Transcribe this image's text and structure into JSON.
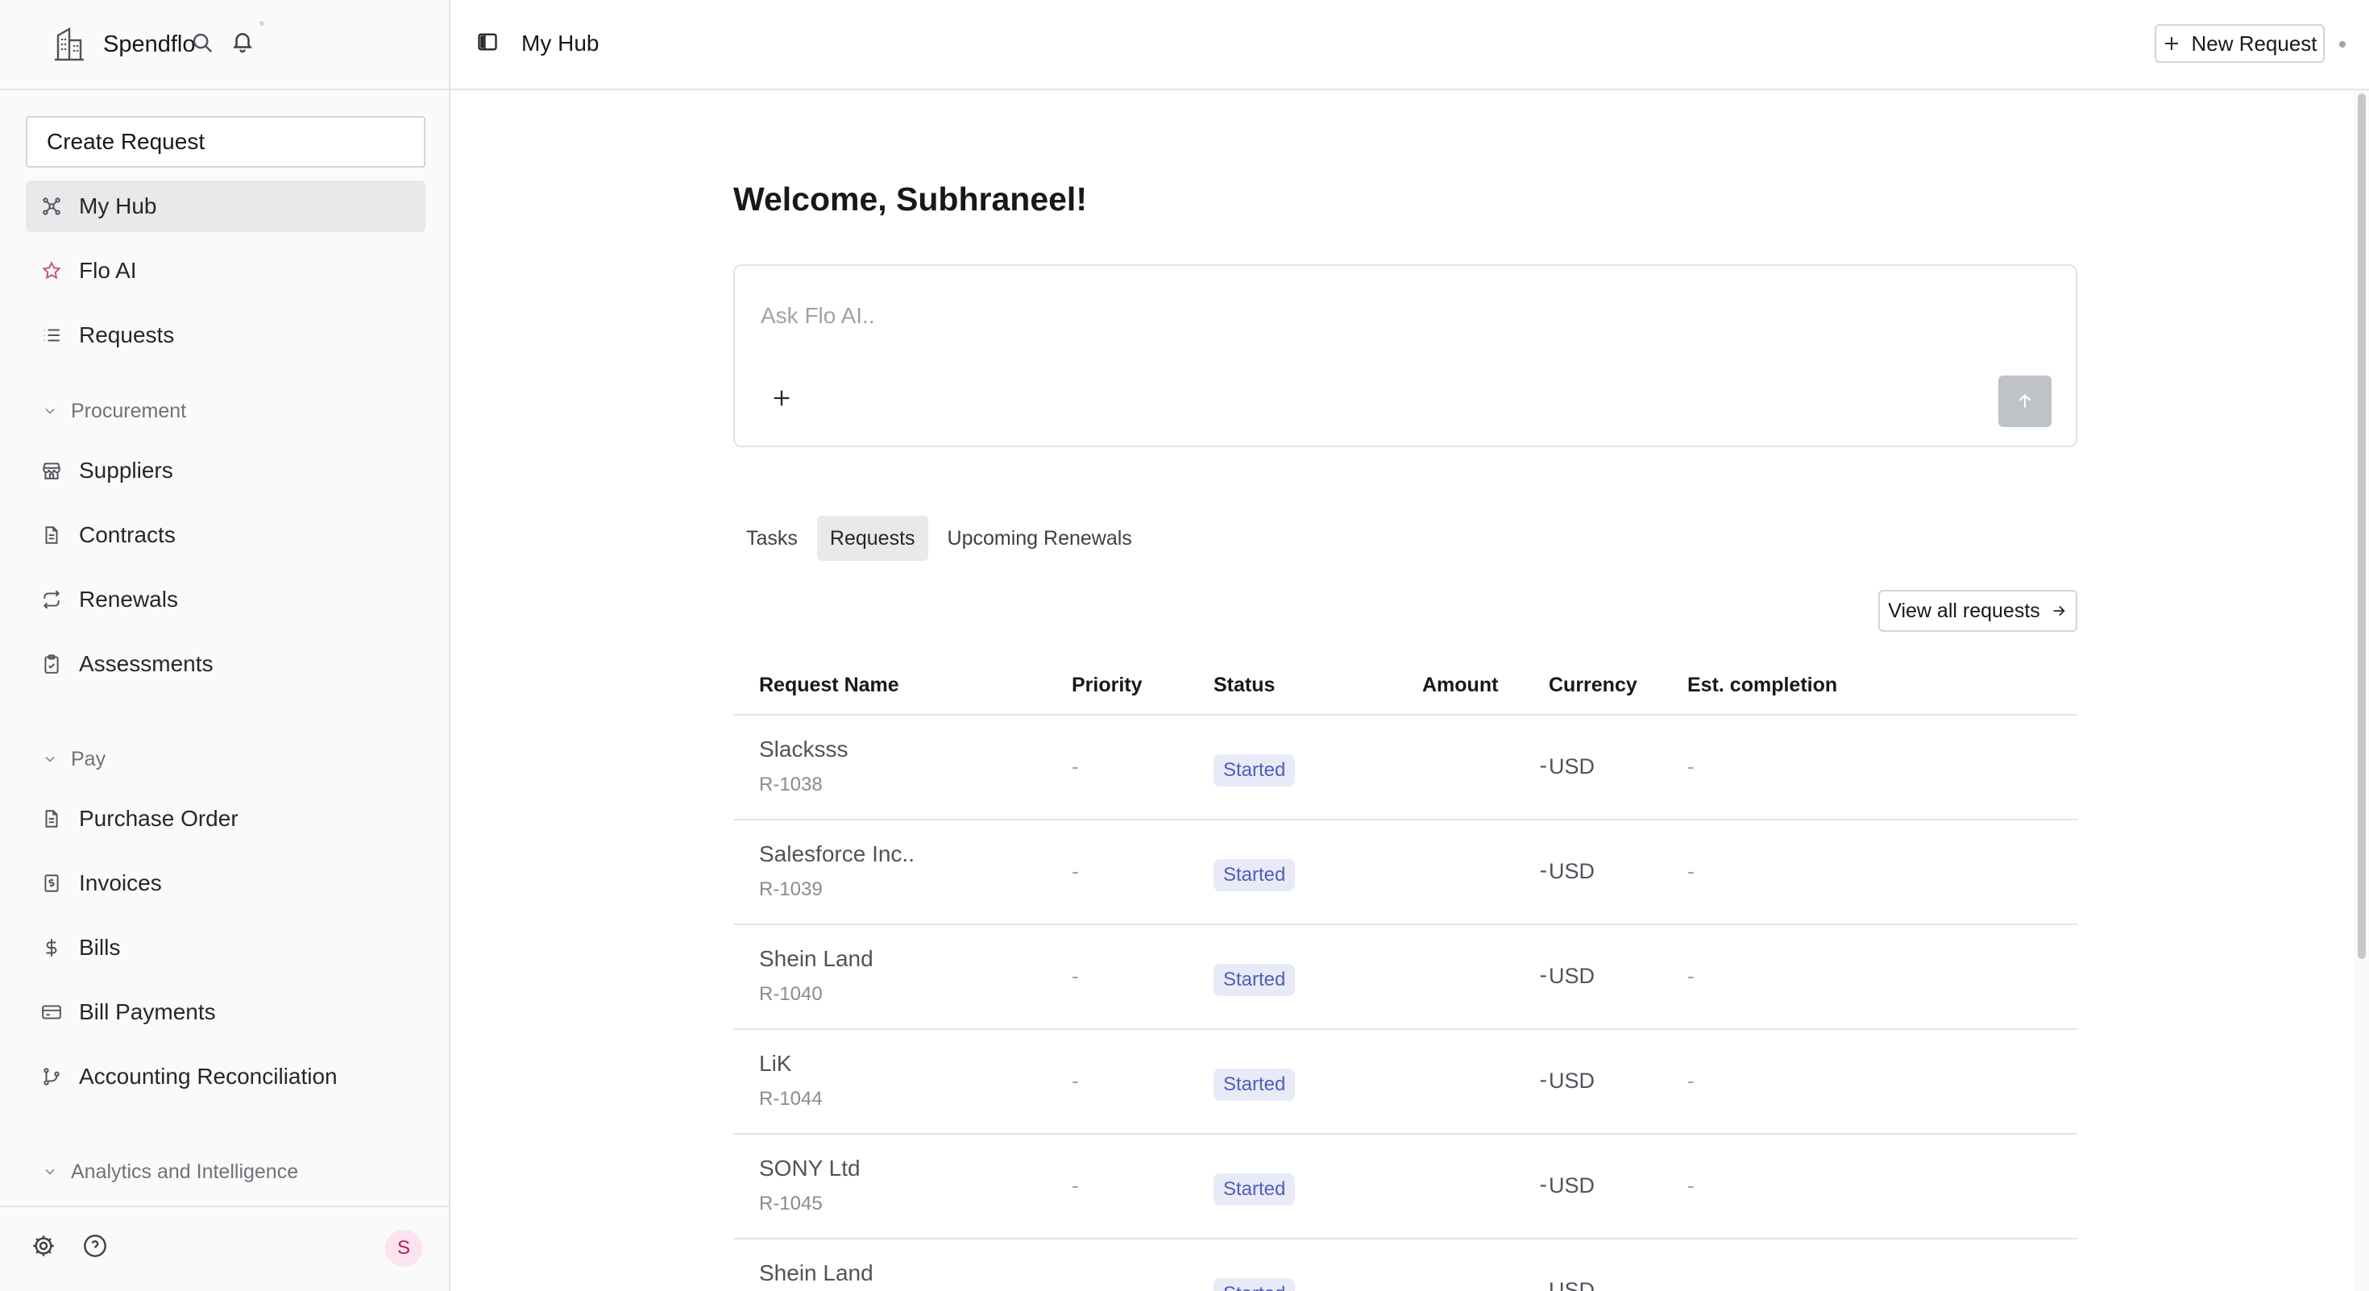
{
  "app": {
    "name": "Spendflo"
  },
  "sidebar": {
    "create_label": "Create Request",
    "top_items": [
      {
        "label": "My Hub",
        "icon": "hub-icon",
        "active": true
      },
      {
        "label": "Flo AI",
        "icon": "star-icon",
        "active": false
      },
      {
        "label": "Requests",
        "icon": "list-icon",
        "active": false
      }
    ],
    "sections": [
      {
        "title": "Procurement",
        "items": [
          {
            "label": "Suppliers",
            "icon": "store-icon"
          },
          {
            "label": "Contracts",
            "icon": "document-icon"
          },
          {
            "label": "Renewals",
            "icon": "repeat-icon"
          },
          {
            "label": "Assessments",
            "icon": "clipboard-icon"
          }
        ]
      },
      {
        "title": "Pay",
        "items": [
          {
            "label": "Purchase Order",
            "icon": "document-icon"
          },
          {
            "label": "Invoices",
            "icon": "receipt-icon"
          },
          {
            "label": "Bills",
            "icon": "dollar-icon"
          },
          {
            "label": "Bill Payments",
            "icon": "credit-card-icon"
          },
          {
            "label": "Accounting Reconciliation",
            "icon": "git-branch-icon"
          }
        ]
      },
      {
        "title": "Analytics and Intelligence",
        "items": []
      }
    ],
    "footer": {
      "avatar_initial": "S"
    }
  },
  "header": {
    "title": "My Hub",
    "new_request_label": "New Request"
  },
  "main": {
    "welcome": "Welcome, Subhraneel!",
    "ask_placeholder": "Ask Flo AI..",
    "tabs": [
      {
        "label": "Tasks",
        "active": false
      },
      {
        "label": "Requests",
        "active": true
      },
      {
        "label": "Upcoming Renewals",
        "active": false
      }
    ],
    "view_all_label": "View all requests",
    "table": {
      "columns": [
        "Request Name",
        "Priority",
        "Status",
        "Amount",
        "Currency",
        "Est. completion"
      ],
      "rows": [
        {
          "name": "Slacksss",
          "id": "R-1038",
          "priority": "-",
          "status": "Started",
          "amount": "-",
          "currency": "USD",
          "est": "-"
        },
        {
          "name": "Salesforce Inc..",
          "id": "R-1039",
          "priority": "-",
          "status": "Started",
          "amount": "-",
          "currency": "USD",
          "est": "-"
        },
        {
          "name": "Shein Land",
          "id": "R-1040",
          "priority": "-",
          "status": "Started",
          "amount": "-",
          "currency": "USD",
          "est": "-"
        },
        {
          "name": "LiK",
          "id": "R-1044",
          "priority": "-",
          "status": "Started",
          "amount": "-",
          "currency": "USD",
          "est": "-"
        },
        {
          "name": "SONY Ltd",
          "id": "R-1045",
          "priority": "-",
          "status": "Started",
          "amount": "-",
          "currency": "USD",
          "est": "-"
        },
        {
          "name": "Shein Land",
          "id": "",
          "priority": "",
          "status": "Started",
          "amount": "",
          "currency": "USD",
          "est": ""
        }
      ]
    }
  }
}
